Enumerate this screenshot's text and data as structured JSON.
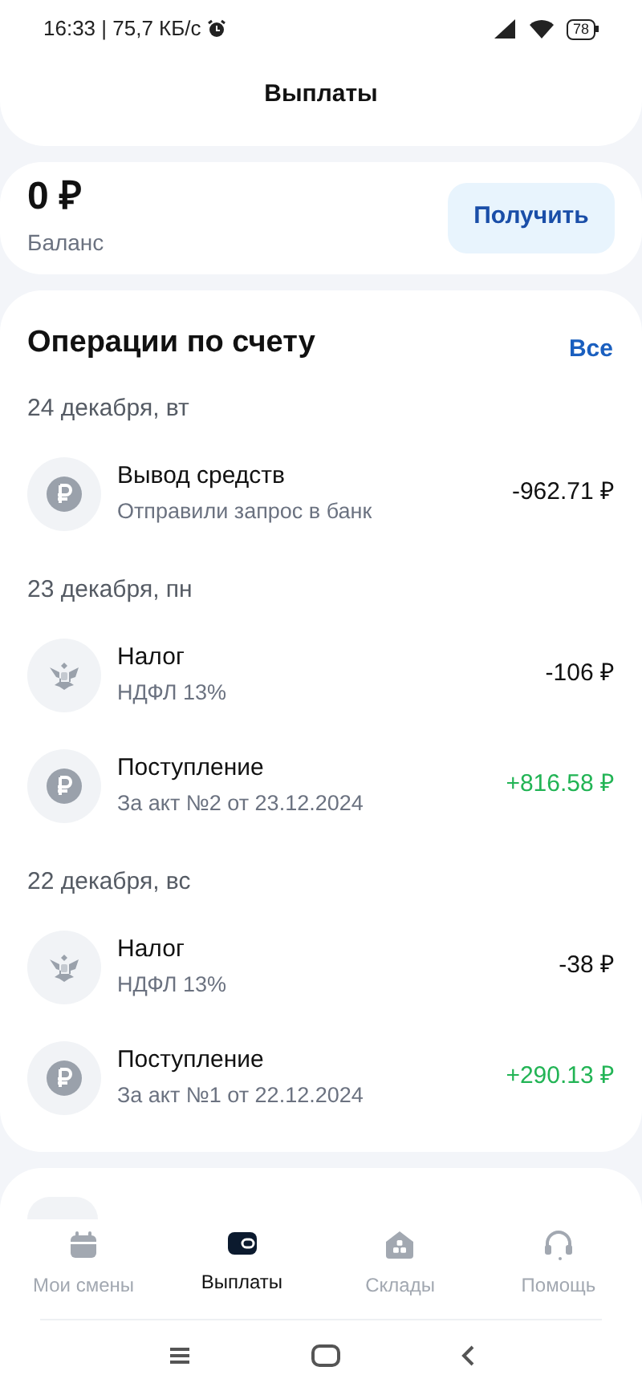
{
  "status_bar": {
    "text": "16:33 | 75,7 КБ/с",
    "battery": "78"
  },
  "header": {
    "title": "Выплаты"
  },
  "balance": {
    "amount": "0 ₽",
    "label": "Баланс",
    "button": "Получить"
  },
  "operations": {
    "title": "Операции по счету",
    "all_link": "Все",
    "groups": [
      {
        "date": "24 декабря, вт",
        "items": [
          {
            "title": "Вывод средств",
            "subtitle": "Отправили запрос в банк",
            "amount": "-962.71 ₽",
            "kind": "withdrawal"
          }
        ]
      },
      {
        "date": "23 декабря, пн",
        "items": [
          {
            "title": "Налог",
            "subtitle": "НДФЛ 13%",
            "amount": "-106 ₽",
            "kind": "tax"
          },
          {
            "title": "Поступление",
            "subtitle": "За акт №2 от 23.12.2024",
            "amount": "+816.58 ₽",
            "kind": "income"
          }
        ]
      },
      {
        "date": "22 декабря, вс",
        "items": [
          {
            "title": "Налог",
            "subtitle": "НДФЛ 13%",
            "amount": "-38 ₽",
            "kind": "tax"
          },
          {
            "title": "Поступление",
            "subtitle": "За акт №1 от 22.12.2024",
            "amount": "+290.13 ₽",
            "kind": "income"
          }
        ]
      }
    ]
  },
  "bottom_nav": [
    {
      "label": "Мои смены",
      "selected": false
    },
    {
      "label": "Выплаты",
      "selected": true
    },
    {
      "label": "Склады",
      "selected": false
    },
    {
      "label": "Помощь",
      "selected": false
    }
  ]
}
